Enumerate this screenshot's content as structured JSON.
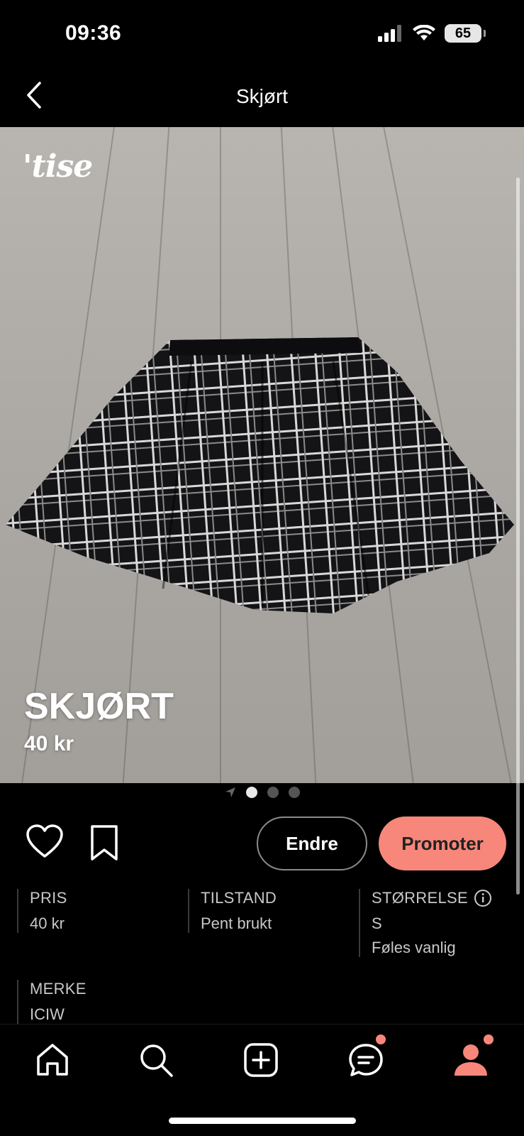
{
  "status_bar": {
    "time": "09:36",
    "battery": "65",
    "icons": [
      "signal-icon",
      "wifi-icon",
      "battery-icon"
    ]
  },
  "nav": {
    "title": "Skjørt",
    "back_icon": "chevron-left-icon"
  },
  "listing": {
    "logo": "'tise",
    "title": "SKJØRT",
    "price": "40 kr",
    "pager": {
      "count": 3,
      "active_index": 0
    }
  },
  "actions": {
    "edit_label": "Endre",
    "promote_label": "Promoter",
    "accent_color": "#f7877a"
  },
  "details": {
    "price": {
      "label": "PRIS",
      "value": "40 kr"
    },
    "condition": {
      "label": "TILSTAND",
      "value": "Pent brukt"
    },
    "size": {
      "label": "STØRRELSE",
      "value": "S",
      "fit": "Føles vanlig"
    },
    "brand": {
      "label": "MERKE",
      "value": "ICIW"
    }
  },
  "tab_bar": {
    "items": [
      "home-icon",
      "search-icon",
      "add-icon",
      "messages-icon",
      "profile-icon"
    ],
    "active": "profile-icon"
  }
}
